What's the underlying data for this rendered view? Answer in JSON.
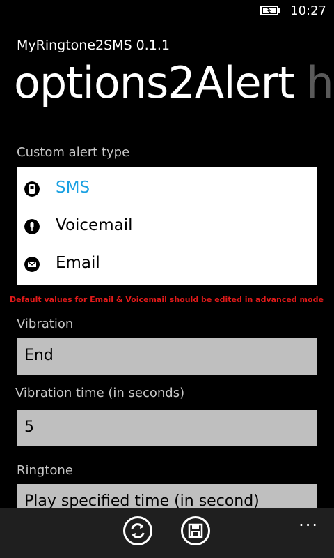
{
  "status": {
    "time": "10:27",
    "battery_icon": "battery-charging-icon"
  },
  "app": {
    "title": "MyRingtone2SMS 0.1.1"
  },
  "pivot": {
    "current": "options2Alert",
    "next_peek": "h"
  },
  "alert_type": {
    "label": "Custom alert type",
    "options": [
      {
        "label": "SMS",
        "icon": "sms-icon",
        "selected": true
      },
      {
        "label": "Voicemail",
        "icon": "microphone-icon",
        "selected": false
      },
      {
        "label": "Email",
        "icon": "envelope-icon",
        "selected": false
      }
    ]
  },
  "warning": "Default values for Email & Voicemail should be edited in advanced mode",
  "vibration": {
    "label": "Vibration",
    "value": "End"
  },
  "vibration_time": {
    "label": "Vibration time (in seconds)",
    "value": "5"
  },
  "ringtone": {
    "label": "Ringtone",
    "value": "Play specified time (in second)"
  },
  "appbar": {
    "buttons": [
      "refresh-icon",
      "save-icon"
    ],
    "more": "..."
  },
  "colors": {
    "accent": "#1ba1e2",
    "warning": "#e31a1a",
    "field_bg": "#bfbfbf",
    "appbar_bg": "#1f1f1f"
  }
}
